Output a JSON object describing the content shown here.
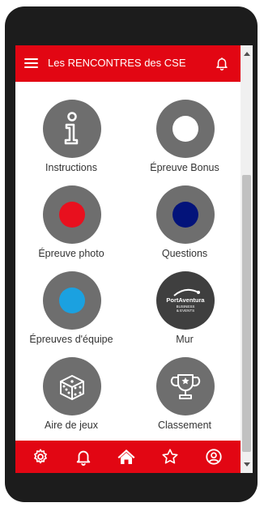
{
  "header": {
    "title": "Les RENCONTRES des CSE",
    "menu_icon": "hamburger-icon",
    "notification_icon": "bell-icon"
  },
  "tiles": [
    {
      "label": "Instructions",
      "icon": "info-icon"
    },
    {
      "label": "Épreuve Bonus",
      "icon": "white-dot-icon"
    },
    {
      "label": "Épreuve photo",
      "icon": "red-dot-icon"
    },
    {
      "label": "Questions",
      "icon": "navy-dot-icon"
    },
    {
      "label": "Épreuves d'équipe",
      "icon": "blue-dot-icon"
    },
    {
      "label": "Mur",
      "icon": "portaventura-logo"
    },
    {
      "label": "Aire de jeux",
      "icon": "dice-icon"
    },
    {
      "label": "Classement",
      "icon": "trophy-icon"
    }
  ],
  "logo": {
    "line1": "PortAventura",
    "line2": "BUSINESS",
    "line3": "& EVENTS"
  },
  "bottom_nav": [
    "gear-icon",
    "bell-icon",
    "home-icon",
    "star-icon",
    "user-icon"
  ],
  "colors": {
    "brand_red": "#e20613",
    "circle_gray": "#6e6e6e",
    "dot_red": "#e8101e",
    "dot_navy": "#03137a",
    "dot_blue": "#1ba1e0",
    "dot_white": "#ffffff"
  }
}
